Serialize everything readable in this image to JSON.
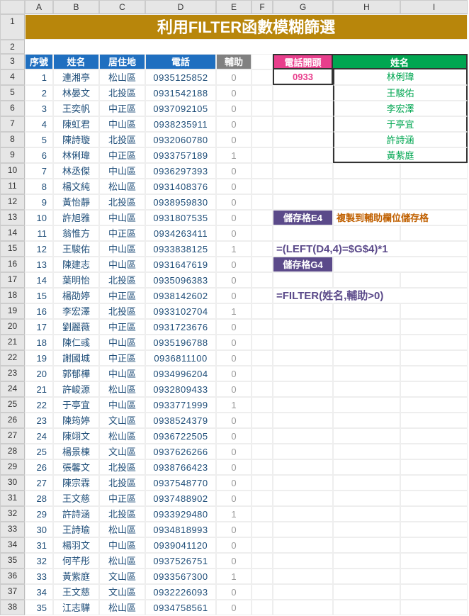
{
  "columns": [
    "A",
    "B",
    "C",
    "D",
    "E",
    "F",
    "G",
    "H",
    "I"
  ],
  "row_count": 38,
  "title": "利用FILTER函數模糊篩選",
  "headers": {
    "serial": "序號",
    "name": "姓名",
    "area": "居住地",
    "phone": "電話",
    "aux": "輔助"
  },
  "filter": {
    "phone_prefix_label": "電話開頭",
    "name_label": "姓名",
    "key": "0933"
  },
  "result_names": [
    "林俐瑋",
    "王駿佑",
    "李宏澤",
    "于亭宜",
    "許詩涵",
    "黃紫庭"
  ],
  "notes": {
    "cell_e4": "儲存格E4",
    "copy_note": "複製到輔助欄位儲存格",
    "formula1": "=(LEFT(D4,4)=$G$4)*1",
    "cell_g4": "儲存格G4",
    "formula2": "=FILTER(姓名,輔助>0)"
  },
  "chart_data": {
    "type": "table",
    "columns": [
      "序號",
      "姓名",
      "居住地",
      "電話",
      "輔助"
    ],
    "rows": [
      [
        1,
        "連湘亭",
        "松山區",
        "0935125852",
        0
      ],
      [
        2,
        "林晏文",
        "北投區",
        "0931542188",
        0
      ],
      [
        3,
        "王奕帆",
        "中正區",
        "0937092105",
        0
      ],
      [
        4,
        "陳虹君",
        "中山區",
        "0938235911",
        0
      ],
      [
        5,
        "陳詩璇",
        "北投區",
        "0932060780",
        0
      ],
      [
        6,
        "林俐瑋",
        "中正區",
        "0933757189",
        1
      ],
      [
        7,
        "林丞傑",
        "中山區",
        "0936297393",
        0
      ],
      [
        8,
        "楊文純",
        "松山區",
        "0931408376",
        0
      ],
      [
        9,
        "黃怡靜",
        "北投區",
        "0938959830",
        0
      ],
      [
        10,
        "許旭雅",
        "中山區",
        "0931807535",
        0
      ],
      [
        11,
        "翁惟方",
        "中正區",
        "0934263411",
        0
      ],
      [
        12,
        "王駿佑",
        "中山區",
        "0933838125",
        1
      ],
      [
        13,
        "陳建志",
        "中山區",
        "0931647619",
        0
      ],
      [
        14,
        "葉明怡",
        "北投區",
        "0935096383",
        0
      ],
      [
        15,
        "楊劭婷",
        "中正區",
        "0938142602",
        0
      ],
      [
        16,
        "李宏澤",
        "北投區",
        "0933102704",
        1
      ],
      [
        17,
        "劉麗薇",
        "中正區",
        "0931723676",
        0
      ],
      [
        18,
        "陳仁彧",
        "中山區",
        "0935196788",
        0
      ],
      [
        19,
        "謝國城",
        "中正區",
        "0936811100",
        0
      ],
      [
        20,
        "郭郁樺",
        "中山區",
        "0934996204",
        0
      ],
      [
        21,
        "許峻源",
        "松山區",
        "0932809433",
        0
      ],
      [
        22,
        "于亭宜",
        "中山區",
        "0933771999",
        1
      ],
      [
        23,
        "陳筠婷",
        "文山區",
        "0938524379",
        0
      ],
      [
        24,
        "陳翊文",
        "松山區",
        "0936722505",
        0
      ],
      [
        25,
        "楊景棟",
        "文山區",
        "0937626266",
        0
      ],
      [
        26,
        "張馨文",
        "北投區",
        "0938766423",
        0
      ],
      [
        27,
        "陳宗霖",
        "北投區",
        "0937548770",
        0
      ],
      [
        28,
        "王文慈",
        "中正區",
        "0937488902",
        0
      ],
      [
        29,
        "許詩涵",
        "北投區",
        "0933929480",
        1
      ],
      [
        30,
        "王詩瑜",
        "松山區",
        "0934818993",
        0
      ],
      [
        31,
        "楊羽文",
        "中山區",
        "0939041120",
        0
      ],
      [
        32,
        "何芊彤",
        "松山區",
        "0937526751",
        0
      ],
      [
        33,
        "黃紫庭",
        "文山區",
        "0933567300",
        1
      ],
      [
        34,
        "王文慈",
        "文山區",
        "0932226093",
        0
      ],
      [
        35,
        "江志驊",
        "松山區",
        "0934758561",
        0
      ]
    ]
  }
}
